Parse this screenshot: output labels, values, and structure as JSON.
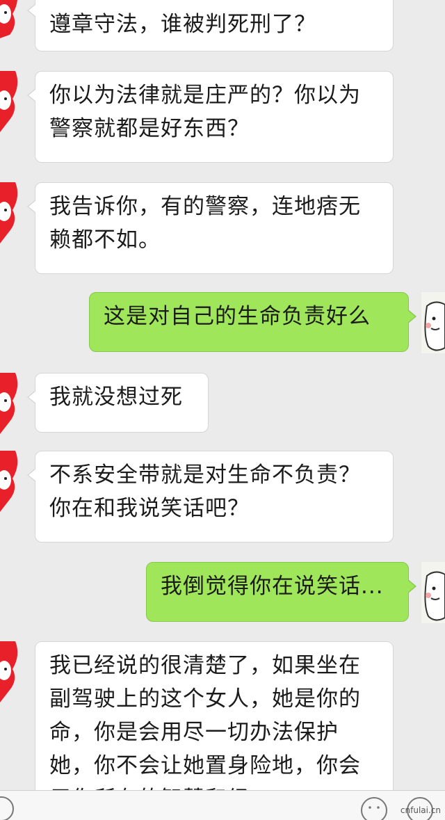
{
  "messages": [
    {
      "side": "left",
      "text": "遵章守法，谁被判死刑了？"
    },
    {
      "side": "left",
      "text": "你以为法律就是庄严的？你以为警察就都是好东西？"
    },
    {
      "side": "left",
      "text": "我告诉你，有的警察，连地痞无赖都不如。"
    },
    {
      "side": "right",
      "text": "这是对自己的生命负责好么"
    },
    {
      "side": "left",
      "text": "我就没想过死"
    },
    {
      "side": "left",
      "text": "不系安全带就是对生命不负责？你在和我说笑话吧？"
    },
    {
      "side": "right",
      "text": "我倒觉得你在说笑话..."
    },
    {
      "side": "left",
      "text": "我已经说的很清楚了，如果坐在副驾驶上的这个女人，她是你的命，你是会用尽一切办法保护她，你不会让她置身险地，你会用你所有的智慧和经"
    }
  ],
  "watermark": "cnfulai.cn",
  "colors": {
    "background": "#ebebeb",
    "left_bubble": "#ffffff",
    "right_bubble": "#9fe65a"
  }
}
